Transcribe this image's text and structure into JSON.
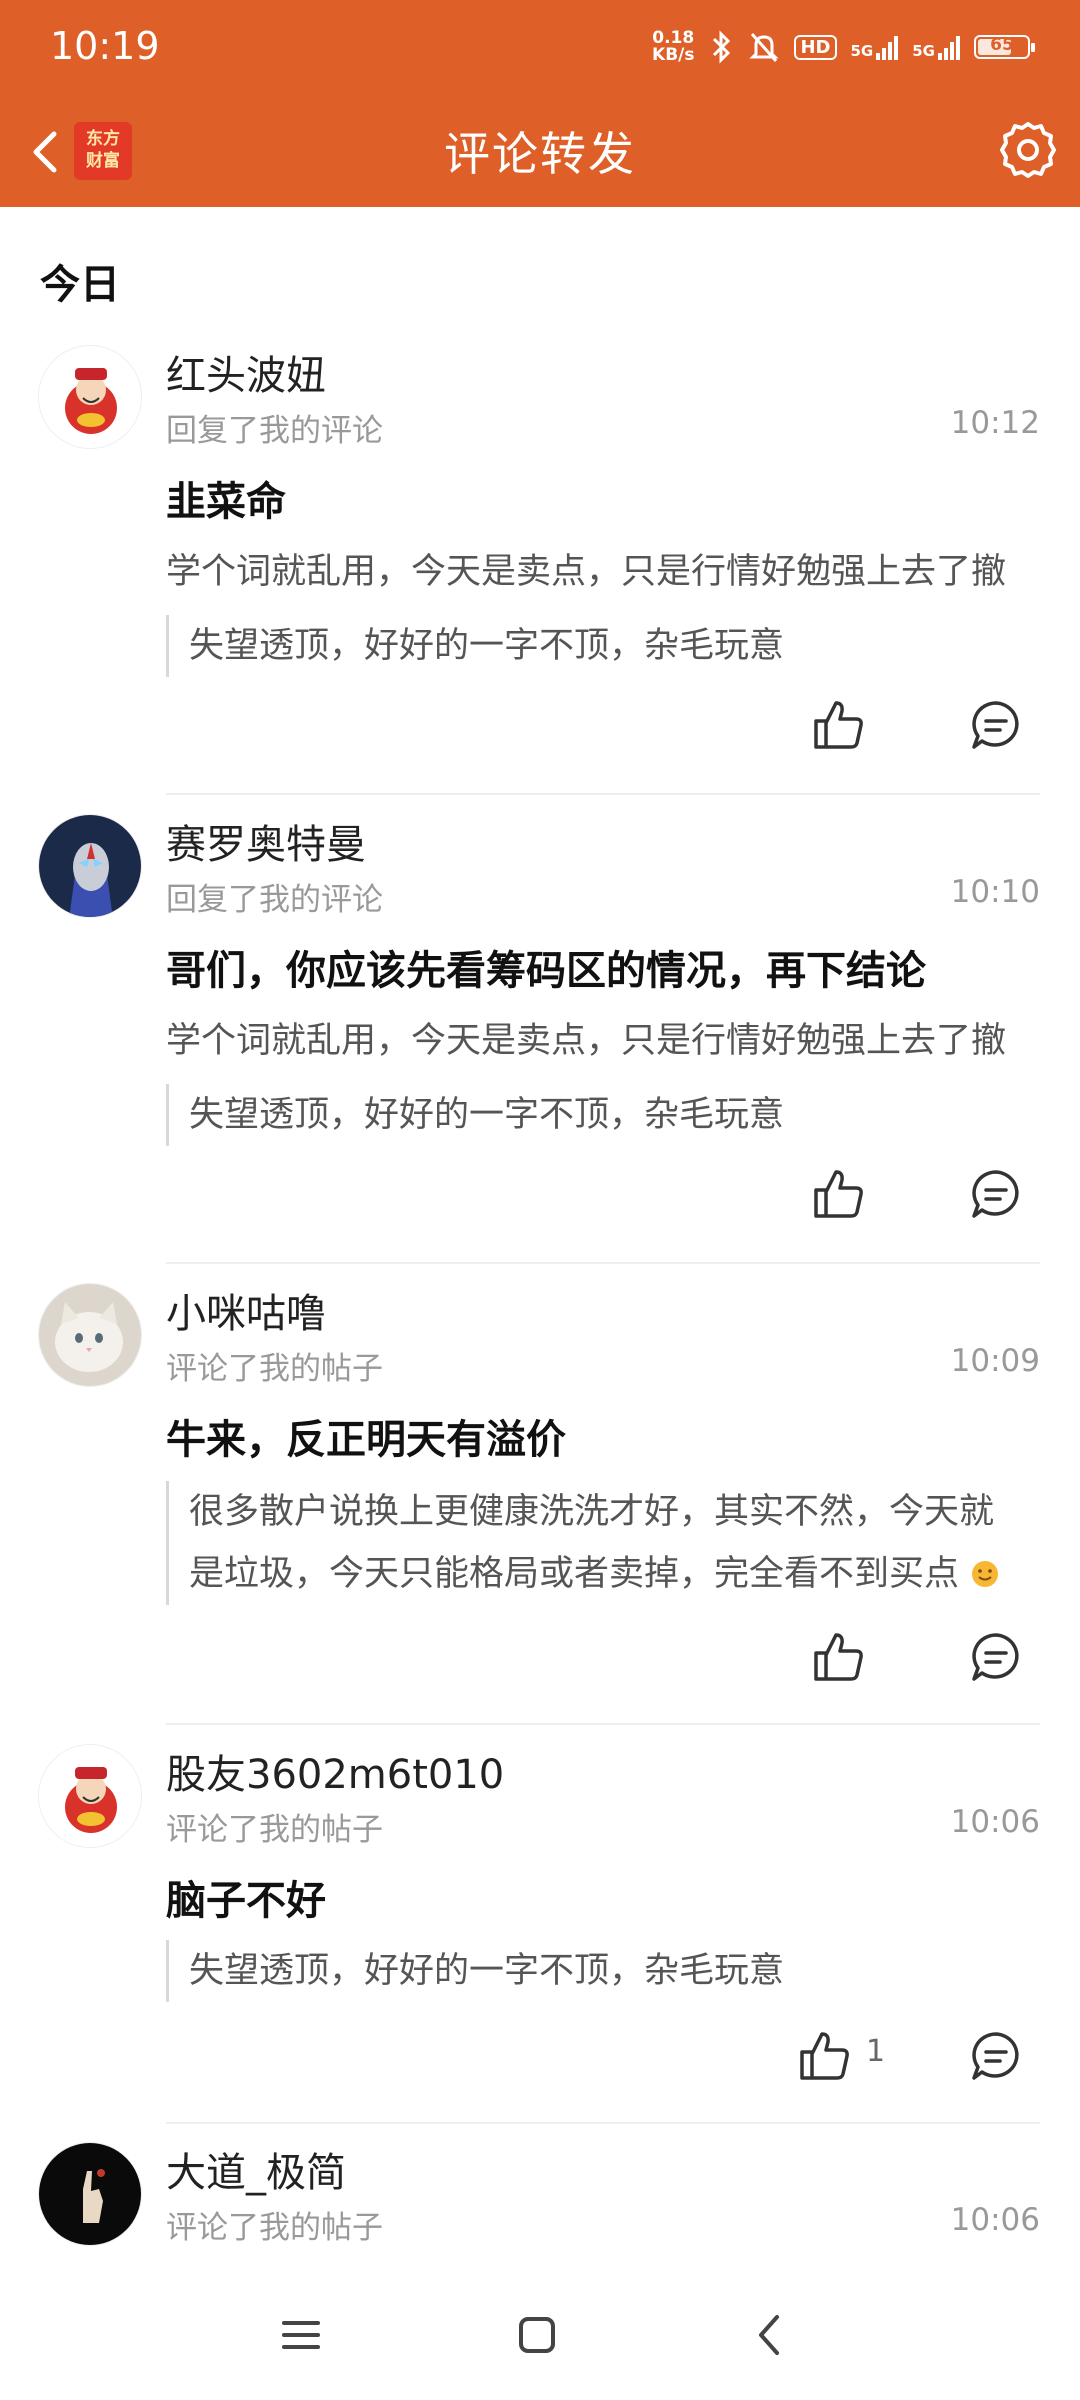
{
  "status_bar": {
    "time": "10:19",
    "net_speed_top": "0.18",
    "net_speed_unit": "KB/s",
    "hd_label": "HD",
    "signal1_label": "5G",
    "signal2_label": "5G",
    "battery_level": "65"
  },
  "header": {
    "logo_line1": "东方",
    "logo_line2": "财富",
    "title": "评论转发",
    "accent_color": "#DE5F28"
  },
  "section_label": "今日",
  "comments": [
    {
      "username": "红头波妞",
      "action": "回复了我的评论",
      "time": "10:12",
      "text": "韭菜命",
      "original": "学个词就乱用，今天是卖点，只是行情好勉强上去了撤",
      "quote": "失望透顶，好好的一字不顶，杂毛玩意"
    },
    {
      "username": "赛罗奥特曼",
      "action": "回复了我的评论",
      "time": "10:10",
      "text": "哥们，你应该先看筹码区的情况，再下结论",
      "original": "学个词就乱用，今天是卖点，只是行情好勉强上去了撤",
      "quote": "失望透顶，好好的一字不顶，杂毛玩意"
    },
    {
      "username": "小咪咕噜",
      "action": "评论了我的帖子",
      "time": "10:09",
      "text": "牛来，反正明天有溢价",
      "quote_line1": "很多散户说换上更健康洗洗才好，其实不然，今天就",
      "quote_line2": "是垃圾，今天只能格局或者卖掉，完全看不到买点"
    },
    {
      "username": "股友3602m6t010",
      "action": "评论了我的帖子",
      "time": "10:06",
      "text": "脑子不好",
      "quote": "失望透顶，好好的一字不顶，杂毛玩意",
      "like_count": "1"
    },
    {
      "username": "大道_极简",
      "action": "评论了我的帖子",
      "time": "10:06"
    }
  ]
}
